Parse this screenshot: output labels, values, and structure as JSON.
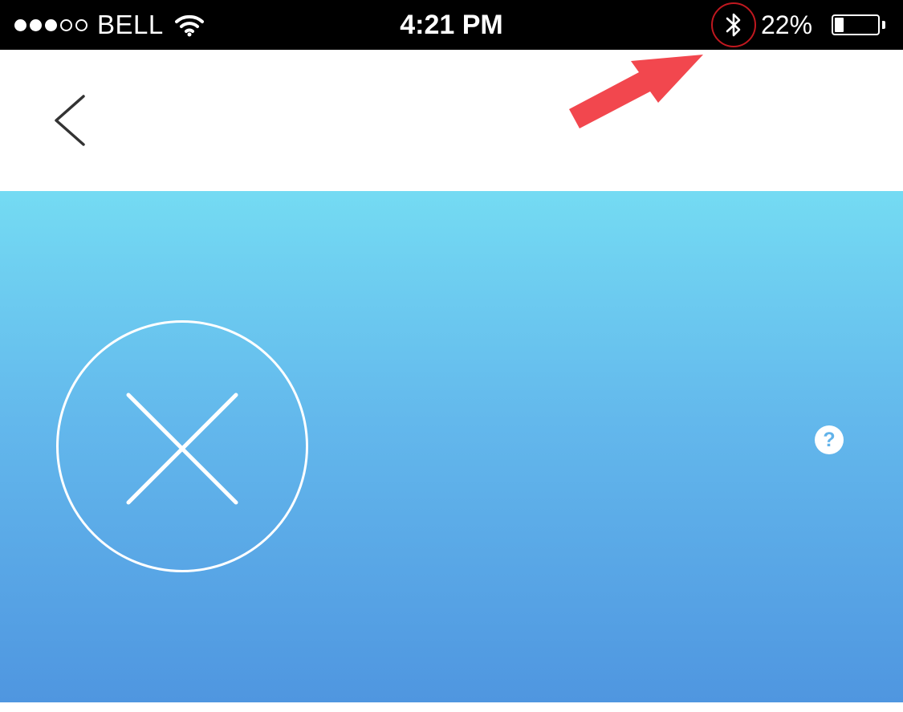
{
  "status_bar": {
    "carrier": "BELL",
    "signal_filled": 3,
    "signal_total": 5,
    "time": "4:21 PM",
    "battery_percent": "22%",
    "battery_level": 0.22,
    "icons": [
      "wifi-icon",
      "bluetooth-icon",
      "battery-icon"
    ]
  },
  "nav": {
    "back_icon": "chevron-left-icon"
  },
  "annotation": {
    "arrow_color": "#f2474e",
    "highlight_color": "#c0181f"
  },
  "main": {
    "status_icon": "x-circle-icon",
    "help_label": "?",
    "gradient_top": "#74dbf3",
    "gradient_bottom": "#4f96e0"
  }
}
